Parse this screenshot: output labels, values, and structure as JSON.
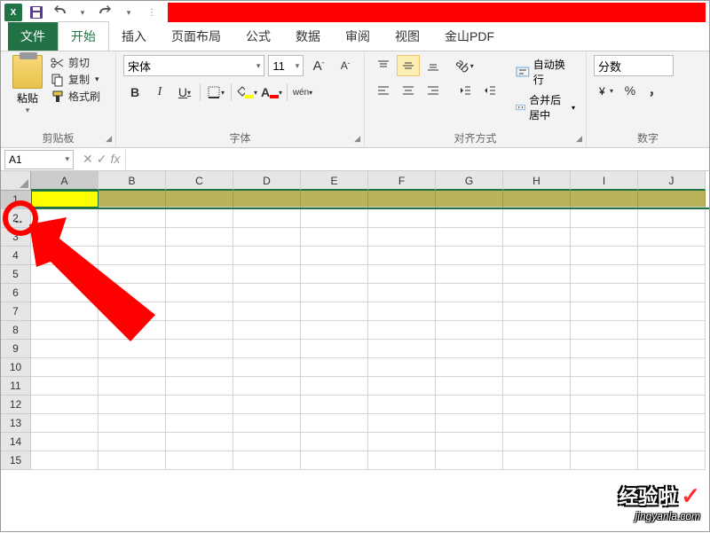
{
  "qat": {
    "save_icon": "save",
    "undo_icon": "undo",
    "redo_icon": "redo"
  },
  "tabs": {
    "file": "文件",
    "items": [
      "开始",
      "插入",
      "页面布局",
      "公式",
      "数据",
      "审阅",
      "视图",
      "金山PDF"
    ],
    "active_index": 0
  },
  "ribbon": {
    "clipboard": {
      "paste_label": "粘贴",
      "cut_label": "剪切",
      "copy_label": "复制",
      "format_painter_label": "格式刷",
      "group_label": "剪贴板"
    },
    "font": {
      "font_name": "宋体",
      "font_size": "11",
      "increase_font_icon": "A",
      "decrease_font_icon": "A",
      "bold_label": "B",
      "italic_label": "I",
      "underline_label": "U",
      "wen_label": "wén",
      "group_label": "字体",
      "fill_color": "#ffff00",
      "font_color": "#ff0000"
    },
    "align": {
      "wrap_label": "自动换行",
      "merge_label": "合并后居中",
      "group_label": "对齐方式"
    },
    "number": {
      "format_value": "分数",
      "percent_label": "%",
      "comma_label": "，",
      "group_label": "数字"
    }
  },
  "formula_bar": {
    "name_box": "A1",
    "cancel_icon": "✕",
    "confirm_icon": "✓",
    "fx_label": "fx",
    "value": ""
  },
  "sheet": {
    "columns": [
      "A",
      "B",
      "C",
      "D",
      "E",
      "F",
      "G",
      "H",
      "I",
      "J"
    ],
    "row_count": 15,
    "selected_row": 1,
    "active_cell_col": "A"
  },
  "row_cursor_glyph": "↔",
  "watermark": {
    "title": "经验啦",
    "check": "✓",
    "url": "jingyanla.com"
  }
}
